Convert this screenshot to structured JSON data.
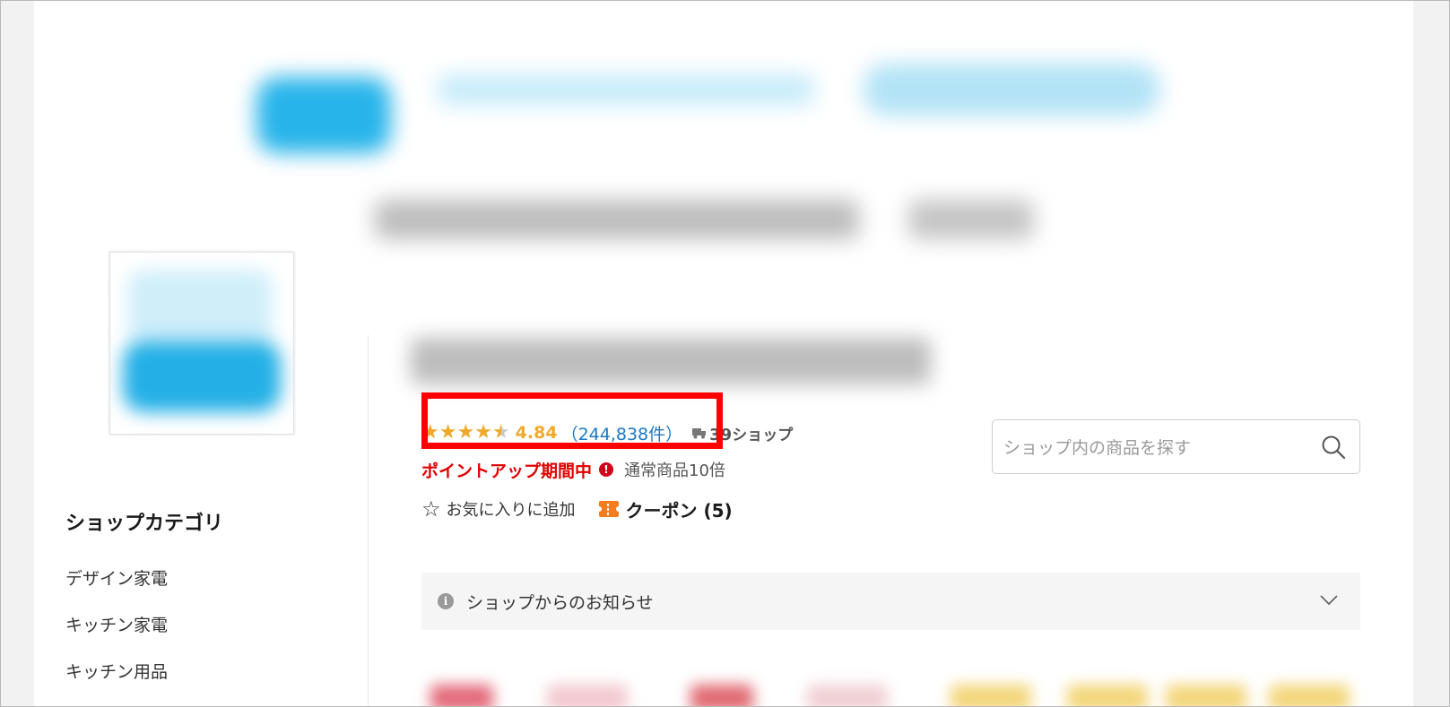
{
  "shop": {
    "rating": {
      "value": "4.84",
      "stars_filled": 4.5,
      "review_count": "（244,838件）"
    },
    "shipping": {
      "icon": "truck-icon",
      "threshold": "39",
      "label": "ショップ"
    },
    "point": {
      "label": "ポイントアップ期間中",
      "normal_text": "通常商品10倍"
    },
    "favorite_label": "お気に入りに追加",
    "coupon_label": "クーポン (5)"
  },
  "sidebar": {
    "title": "ショップカテゴリ",
    "items": [
      {
        "label": "デザイン家電"
      },
      {
        "label": "キッチン家電"
      },
      {
        "label": "キッチン用品"
      }
    ]
  },
  "search": {
    "placeholder": "ショップ内の商品を探す"
  },
  "notice": {
    "label": "ショップからのお知らせ"
  },
  "colors": {
    "star": "#f0a92c",
    "review_link": "#1b79c4",
    "point_red": "#e00000",
    "highlight_box": "#ff0000",
    "brand_blue": "#27b4ea",
    "coupon_orange": "#f57c1f"
  }
}
